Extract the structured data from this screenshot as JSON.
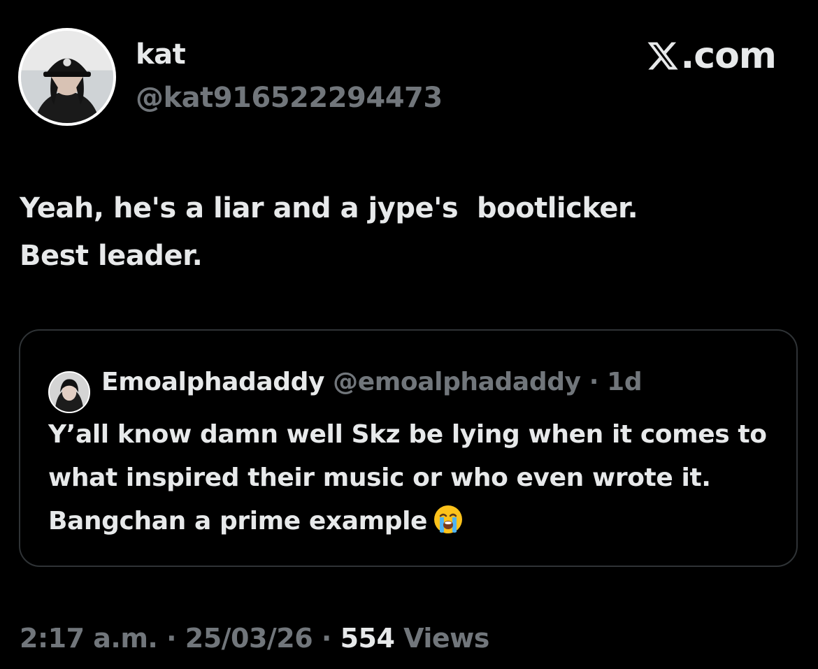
{
  "author": {
    "display_name": "kat",
    "handle": "@kat916522294473"
  },
  "brand": {
    "logo_text": ".com",
    "logo_icon": "x-logo-icon"
  },
  "tweet": {
    "text_line1": "Yeah, he's a liar and a jype's  bootlicker.",
    "text_line2": "Best leader."
  },
  "quoted_tweet": {
    "display_name": "Emoalphadaddy",
    "handle": "@emoalphadaddy",
    "separator": " · ",
    "time": "1d",
    "text": "Y’all know damn well Skz be lying when it comes to what inspired their music or who even wrote it. Bangchan a prime example",
    "emoji": "loudly-crying-face-icon"
  },
  "footer": {
    "time": "2:17 a.m.",
    "sep1": " · ",
    "date": "25/03/26",
    "sep2": " · ",
    "views_count": "554",
    "views_label": " Views"
  },
  "colors": {
    "background": "#000000",
    "primary_text": "#e7e9ea",
    "secondary_text": "#71767b",
    "border": "#2f3336"
  }
}
